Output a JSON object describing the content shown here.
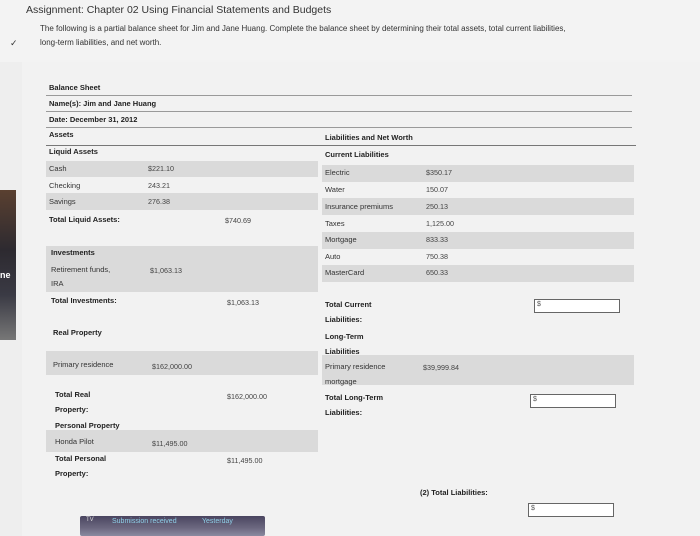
{
  "assignment": {
    "title": "Assignment: Chapter 02 Using Financial Statements and Budgets",
    "instructions_line1": "The following is a partial balance sheet for Jim and Jane Huang. Complete the balance sheet by determining their total assets, total current liabilities,",
    "instructions_line2": "long-term liabilities, and net worth."
  },
  "browser": {
    "chevron": "✓",
    "edge_label": "ne"
  },
  "balance_sheet": {
    "heading": "Balance Sheet",
    "name_line": "Name(s): Jim and Jane Huang",
    "date_line": "Date: December 31, 2012",
    "assets_label": "Assets",
    "liab_label": "Liabilities and Net Worth",
    "liquid": {
      "label": "Liquid Assets",
      "rows": [
        {
          "name": "Cash",
          "value": "$221.10"
        },
        {
          "name": "Checking",
          "value": "243.21"
        },
        {
          "name": "Savings",
          "value": "276.38"
        }
      ],
      "total_label": "Total Liquid Assets:",
      "total_value": "$740.69"
    },
    "investments": {
      "label": "Investments",
      "row_name_line1": "Retirement funds,",
      "row_name_line2": "IRA",
      "row_value": "$1,063.13",
      "total_label": "Total Investments:",
      "total_value": "$1,063.13"
    },
    "real_property": {
      "label": "Real Property",
      "row_name": "Primary residence",
      "row_value": "$162,000.00",
      "total_label_line1": "Total Real",
      "total_label_line2": "Property:",
      "total_value": "$162,000.00"
    },
    "personal_property": {
      "label": "Personal Property",
      "row_name": "Honda Pilot",
      "row_value": "$11,495.00",
      "total_label_line1": "Total Personal",
      "total_label_line2": "Property:",
      "total_value": "$11,495.00"
    },
    "current_liabilities": {
      "label": "Current Liabilities",
      "rows": [
        {
          "name": "Electric",
          "value": "$350.17"
        },
        {
          "name": "Water",
          "value": "150.07"
        },
        {
          "name": "Insurance premiums",
          "value": "250.13"
        },
        {
          "name": "Taxes",
          "value": "1,125.00"
        },
        {
          "name": "Mortgage",
          "value": "833.33"
        },
        {
          "name": "Auto",
          "value": "750.38"
        },
        {
          "name": "MasterCard",
          "value": "650.33"
        }
      ],
      "total_label_line1": "Total Current",
      "total_label_line2": "Liabilities:",
      "answer_prefix": "$"
    },
    "long_term": {
      "label_line1": "Long-Term",
      "label_line2": "Liabilities",
      "row_name_line1": "Primary residence",
      "row_name_line2": "mortgage",
      "row_value": "$39,999.84",
      "total_label_line1": "Total Long-Term",
      "total_label_line2": "Liabilities:",
      "answer_prefix": "$"
    },
    "total_liabilities": {
      "label": "(2) Total Liabilities:",
      "answer_prefix": "$"
    }
  },
  "taskbar": {
    "tv": "TV",
    "submission": "Submission received",
    "yesterday": "Yesterday"
  }
}
